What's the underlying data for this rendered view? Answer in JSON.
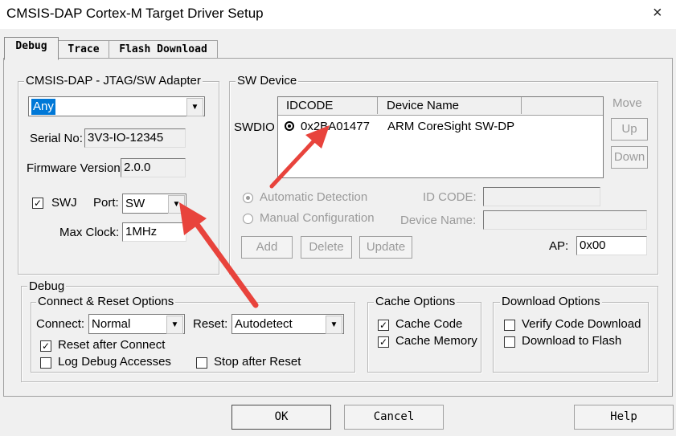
{
  "window": {
    "title": "CMSIS-DAP Cortex-M Target Driver Setup",
    "close_glyph": "×"
  },
  "tabs": [
    {
      "label": "Debug"
    },
    {
      "label": "Trace"
    },
    {
      "label": "Flash Download"
    }
  ],
  "adapter": {
    "group_label": "CMSIS-DAP - JTAG/SW Adapter",
    "selected": "Any",
    "serial_label": "Serial No:",
    "serial_value": "3V3-IO-12345",
    "firmware_label": "Firmware Version:",
    "firmware_value": "2.0.0",
    "swj_label": "SWJ",
    "port_label": "Port:",
    "port_value": "SW",
    "maxclock_label": "Max Clock:",
    "maxclock_value": "1MHz"
  },
  "sw_device": {
    "group_label": "SW Device",
    "swdio_label": "SWDIO",
    "columns": [
      "IDCODE",
      "Device Name"
    ],
    "rows": [
      {
        "idcode": "0x2BA01477",
        "name": "ARM CoreSight SW-DP"
      }
    ],
    "move_label": "Move",
    "up_label": "Up",
    "down_label": "Down",
    "auto_detect_label": "Automatic Detection",
    "manual_config_label": "Manual Configuration",
    "id_code_label": "ID CODE:",
    "device_name_label": "Device Name:",
    "add_label": "Add",
    "delete_label": "Delete",
    "update_label": "Update",
    "ap_label": "AP:",
    "ap_value": "0x00"
  },
  "debug": {
    "group_label": "Debug",
    "connect_reset": {
      "group_label": "Connect & Reset Options",
      "connect_label": "Connect:",
      "connect_value": "Normal",
      "reset_label": "Reset:",
      "reset_value": "Autodetect",
      "reset_after_connect": "Reset after Connect",
      "log_debug": "Log Debug Accesses",
      "stop_after_reset": "Stop after Reset"
    },
    "cache": {
      "group_label": "Cache Options",
      "cache_code": "Cache Code",
      "cache_memory": "Cache Memory"
    },
    "download": {
      "group_label": "Download Options",
      "verify": "Verify Code Download",
      "download_flash": "Download to Flash"
    }
  },
  "footer": {
    "ok": "OK",
    "cancel": "Cancel",
    "help": "Help"
  },
  "check_glyph": "✓",
  "arrow_color": "#e8433c"
}
